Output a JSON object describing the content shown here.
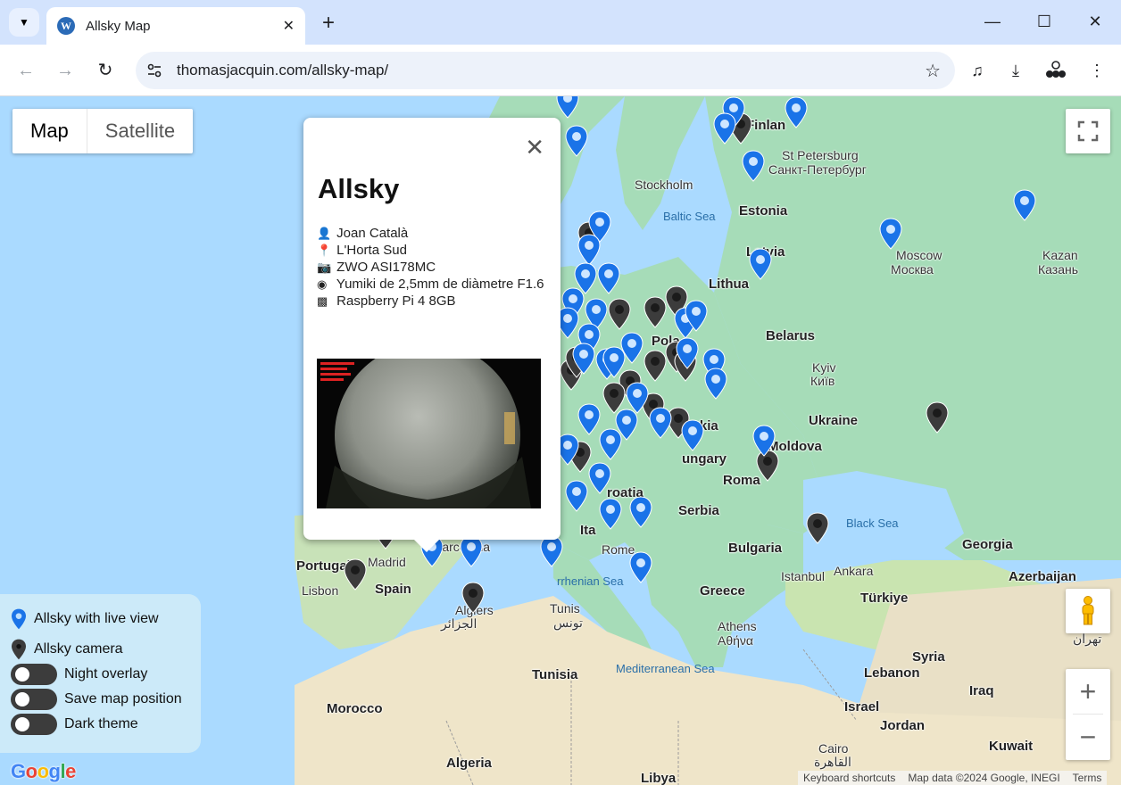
{
  "browser": {
    "tab_title": "Allsky Map",
    "url": "thomasjacquin.com/allsky-map/",
    "favicon_icon": "wordpress-icon"
  },
  "map": {
    "type_map": "Map",
    "type_satellite": "Satellite",
    "labels": {
      "finland": "Finlan",
      "st_petersburg": "St Petersburg",
      "st_petersburg_ru": "Санкт-Петербург",
      "stockholm": "Stockholm",
      "baltic_sea": "Baltic Sea",
      "estonia": "Estonia",
      "latvia": "Latvia",
      "moscow": "Moscow",
      "moscow_ru": "Москва",
      "kazan": "Kazan",
      "kazan_ru": "Казань",
      "lithuania": "Lithua",
      "belarus": "Belarus",
      "kyiv": "Kyiv",
      "kyiv_ua": "Київ",
      "ukraine": "Ukraine",
      "poland": "Pola",
      "slovakia": "ovakia",
      "moldova": "Moldova",
      "hungary": "ungary",
      "romania": "Roma",
      "croatia": "roatia",
      "serbia": "Serbia",
      "italy": "Ita",
      "rome": "Rome",
      "bulgaria": "Bulgaria",
      "black_sea": "Black Sea",
      "georgia": "Georgia",
      "portugal": "Portugal",
      "madrid": "Madrid",
      "barcelona": "Barcelona",
      "lisbon": "Lisbon",
      "spain": "Spain",
      "tyrrhenian_sea": "rrhenian Sea",
      "istanbul": "Istanbul",
      "ankara": "Ankara",
      "turkiye": "Türkiye",
      "azerbaijan": "Azerbaijan",
      "greece": "Greece",
      "algiers": "Algiers",
      "algiers_ar": "الجزائر",
      "tunis": "Tunis",
      "tunis_ar": "تونس",
      "athens": "Athens",
      "athens_gr": "Αθήνα",
      "tunisia": "Tunisia",
      "mediterranean_sea": "Mediterranean Sea",
      "syria": "Syria",
      "lebanon": "Lebanon",
      "iraq": "Iraq",
      "tehran_ar": "تهران",
      "morocco": "Morocco",
      "israel": "Israel",
      "jordan": "Jordan",
      "kuwait": "Kuwait",
      "cairo": "Cairo",
      "cairo_ar": "القاهرة",
      "algeria": "Algeria",
      "libya": "Libya"
    },
    "attribution": {
      "shortcuts": "Keyboard shortcuts",
      "data": "Map data ©2024 Google, INEGI",
      "terms": "Terms"
    },
    "google_logo": "Google",
    "colors": {
      "live_marker": "#1a73e8",
      "camera_marker": "#3c3c3c",
      "land": "#a6dcb8",
      "water": "#aadaff"
    }
  },
  "legend": {
    "live": "Allsky with live view",
    "camera": "Allsky camera",
    "night_overlay": "Night overlay",
    "save_position": "Save map position",
    "dark_theme": "Dark theme"
  },
  "info_window": {
    "title": "Allsky",
    "owner": "Joan Català",
    "location": "L'Horta Sud",
    "camera": "ZWO ASI178MC",
    "lens": "Yumiki de 2,5mm de diàmetre F1.6",
    "computer": "Raspberry Pi 4 8GB"
  }
}
